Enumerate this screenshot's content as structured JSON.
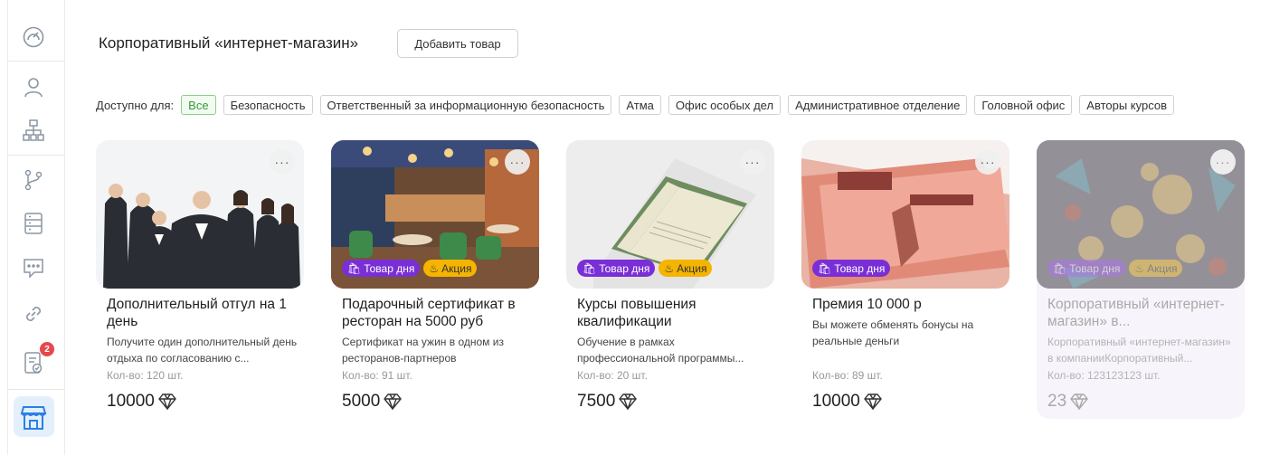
{
  "sidebar": {
    "items": [
      {
        "name": "dashboard-icon"
      },
      {
        "name": "user-icon"
      },
      {
        "name": "org-structure-icon"
      },
      {
        "name": "branch-icon"
      },
      {
        "name": "list-icon"
      },
      {
        "name": "chat-icon"
      },
      {
        "name": "link-icon"
      },
      {
        "name": "tasks-icon",
        "badge": "2"
      },
      {
        "name": "shop-icon",
        "active": true
      }
    ]
  },
  "header": {
    "title": "Корпоративный «интернет-магазин»",
    "add_button": "Добавить товар"
  },
  "filters": {
    "label": "Доступно для:",
    "chips": [
      {
        "label": "Все",
        "active": true
      },
      {
        "label": "Безопасность"
      },
      {
        "label": "Ответственный за информационную безопасность"
      },
      {
        "label": "Атма"
      },
      {
        "label": "Офис особых дел"
      },
      {
        "label": "Административное отделение"
      },
      {
        "label": "Головной офис"
      },
      {
        "label": "Авторы курсов"
      }
    ]
  },
  "tag_labels": {
    "day": "Товар дня",
    "sale": "Акция"
  },
  "products": [
    {
      "title": "Дополнительный отгул на 1 день",
      "description": "Получите один дополнительный день отдыха по согласованию с...",
      "quantity": "Кол-во: 120 шт.",
      "price": "10000",
      "image": "business-team",
      "tags": []
    },
    {
      "title": "Подарочный сертификат в ресторан на 5000 руб",
      "description": "Сертификат на ужин в одном из ресторанов-партнеров",
      "quantity": "Кол-во: 91 шт.",
      "price": "5000",
      "image": "restaurant",
      "tags": [
        "day",
        "sale"
      ]
    },
    {
      "title": "Курсы повышения квалификации",
      "description": "Обучение в рамках профессиональной программы...",
      "quantity": "Кол-во: 20 шт.",
      "price": "7500",
      "image": "certificate",
      "tags": [
        "day",
        "sale"
      ]
    },
    {
      "title": "Премия 10 000 р",
      "description": "Вы можете обменять бонусы на реальные деньги",
      "quantity": "Кол-во: 89 шт.",
      "price": "10000",
      "image": "banknotes",
      "tags": [
        "day"
      ]
    },
    {
      "title": "Корпоративный «интернет-магазин» в...",
      "description": "Корпоративный «интернет-магазин» в компанииКорпоративный...",
      "quantity": "Кол-во: 123123123 шт.",
      "price": "23",
      "image": "crypto-coins",
      "tags": [
        "day",
        "sale"
      ],
      "disabled": true
    }
  ],
  "colors": {
    "accent": "#2f7ee6",
    "tag_day": "#7a2fd6",
    "tag_sale": "#f4b400",
    "chip_active": "#3a9a3a"
  }
}
